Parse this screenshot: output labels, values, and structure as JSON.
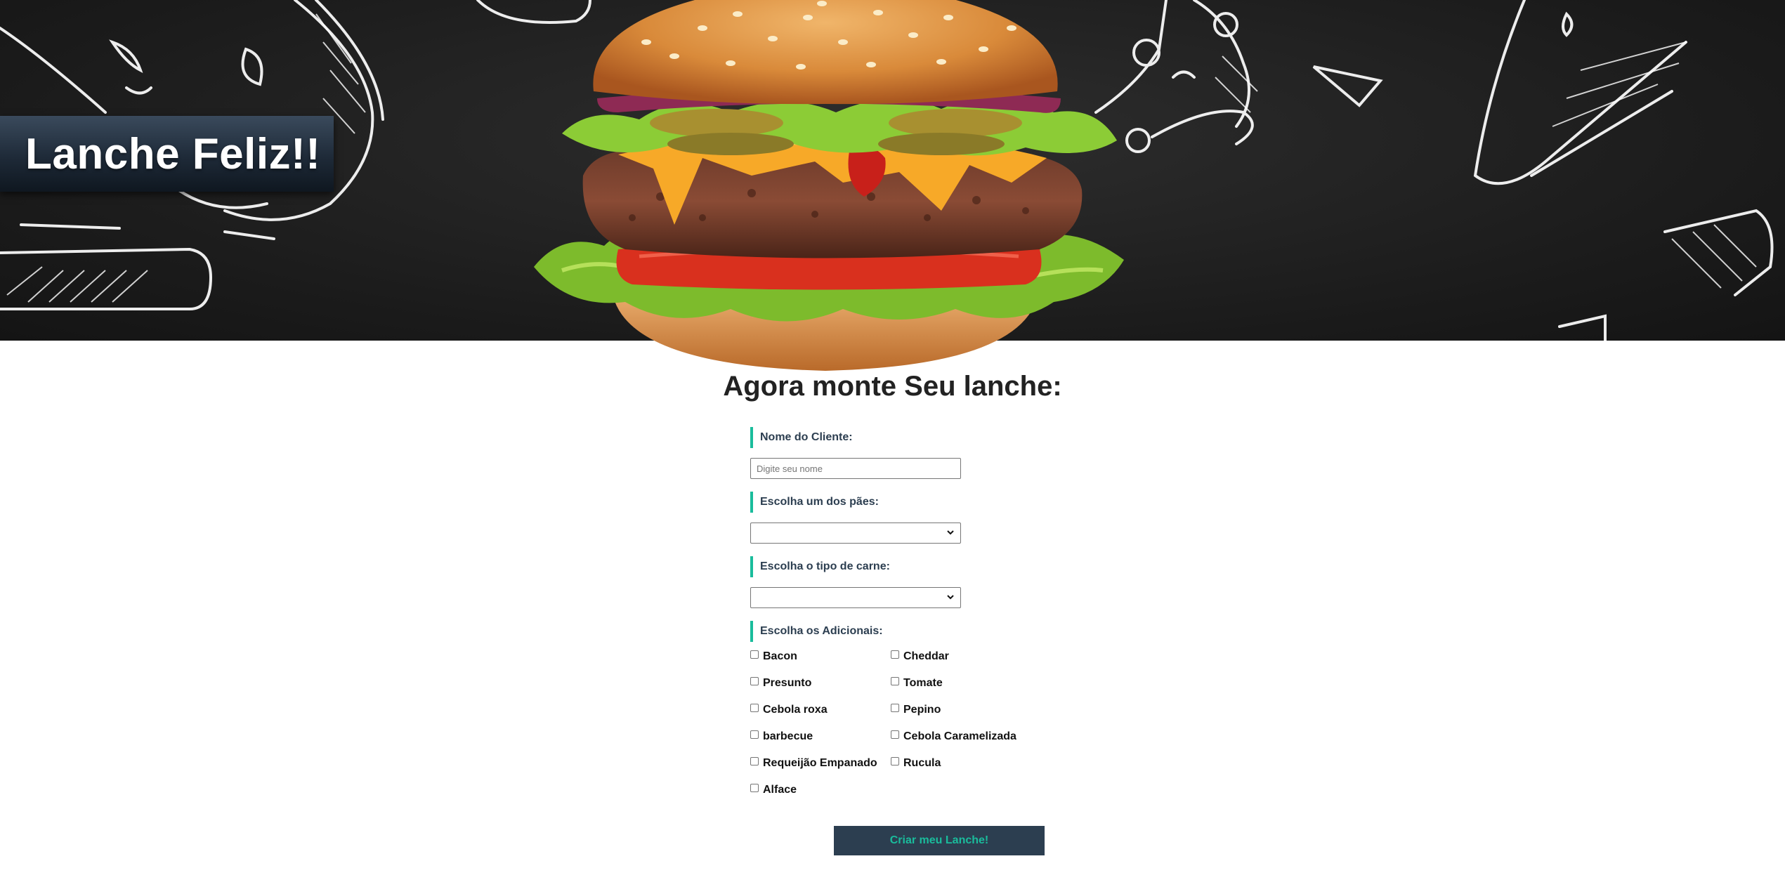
{
  "hero": {
    "title": "Lanche Feliz!!",
    "image": "burger-illustration"
  },
  "form": {
    "heading": "Agora monte Seu lanche:",
    "cliente": {
      "label": "Nome do Cliente:",
      "placeholder": "Digite seu nome",
      "value": ""
    },
    "pao": {
      "label": "Escolha um dos pães:",
      "selected": ""
    },
    "carne": {
      "label": "Escolha o tipo de carne:",
      "selected": ""
    },
    "adicionais": {
      "label": "Escolha os Adicionais:",
      "left": [
        "Bacon",
        "Presunto",
        "Cebola roxa",
        "barbecue",
        "Requeijão Empanado",
        "Alface"
      ],
      "right": [
        "Cheddar",
        "Tomate",
        "Pepino",
        "Cebola Caramelizada",
        "Rucula"
      ]
    },
    "submit_label": "Criar meu Lanche!"
  },
  "colors": {
    "accent": "#1abc9c",
    "dark": "#2c3e50",
    "banner_bg": "#1b1b1b"
  }
}
